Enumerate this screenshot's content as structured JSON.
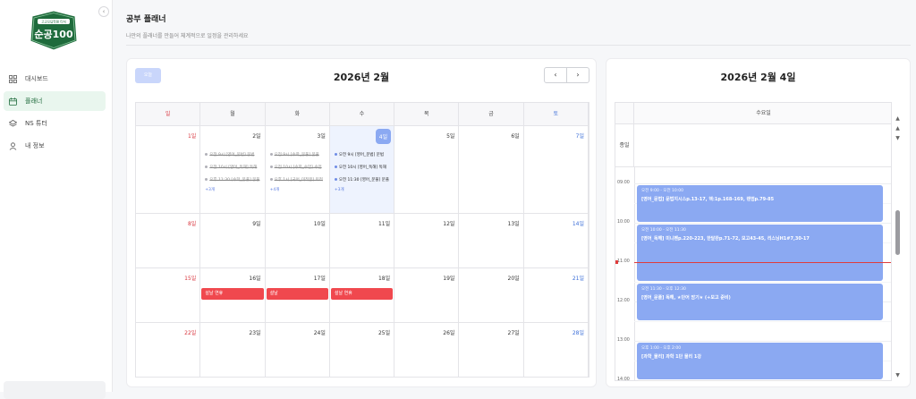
{
  "sidebar": {
    "collapse_icon": "‹",
    "logo_badge": "고교오답학원 티처",
    "logo_text": "순공100",
    "items": [
      {
        "label": "대시보드",
        "icon": "grid-icon",
        "active": false
      },
      {
        "label": "플래너",
        "icon": "calendar-icon",
        "active": true
      },
      {
        "label": "NS 튜터",
        "icon": "layers-icon",
        "active": false
      },
      {
        "label": "내 정보",
        "icon": "user-icon",
        "active": false
      }
    ]
  },
  "header": {
    "title": "공부 플래너",
    "subtitle": "나만의 플래너를 만들어 체계적으로 일정을 관리하세요"
  },
  "calendar": {
    "today_label": "오늘",
    "month_title": "2026년 2월",
    "prev": "‹",
    "next": "›",
    "weekdays": [
      "일",
      "월",
      "화",
      "수",
      "목",
      "금",
      "토"
    ],
    "weeks": [
      [
        {
          "num": "1일",
          "events": []
        },
        {
          "num": "2일",
          "events": [
            {
              "text": "오전 9시 [영어_문법] 문법",
              "done": true
            },
            {
              "text": "오전 10시 [영어_독해] 독해",
              "done": true
            },
            {
              "text": "오후 11:30 [수학_문풀] 문풀",
              "done": true
            }
          ],
          "more": "+3개"
        },
        {
          "num": "3일",
          "events": [
            {
              "text": "오전 9시 [수학_문풀] 문풀",
              "done": true
            },
            {
              "text": "오전 10시 [수학_수업] 수업",
              "done": true
            },
            {
              "text": "오후 1시 [국어_미적분] 미적",
              "done": true
            }
          ],
          "more": "+4개"
        },
        {
          "num": "4일",
          "today": true,
          "events": [
            {
              "text": "오전 9시 [영어_문법] 문법",
              "done": false
            },
            {
              "text": "오전 10시 [영어_독해] 독해",
              "done": false
            },
            {
              "text": "오전 11:30 [영어_문풀] 문풀",
              "done": false
            }
          ],
          "more": "+3개"
        },
        {
          "num": "5일",
          "events": []
        },
        {
          "num": "6일",
          "events": []
        },
        {
          "num": "7일",
          "events": []
        }
      ],
      [
        {
          "num": "8일"
        },
        {
          "num": "9일"
        },
        {
          "num": "10일"
        },
        {
          "num": "11일"
        },
        {
          "num": "12일"
        },
        {
          "num": "13일"
        },
        {
          "num": "14일"
        }
      ],
      [
        {
          "num": "15일"
        },
        {
          "num": "16일"
        },
        {
          "num": "17일"
        },
        {
          "num": "18일"
        },
        {
          "num": "19일"
        },
        {
          "num": "20일"
        },
        {
          "num": "21일"
        }
      ],
      [
        {
          "num": "22일"
        },
        {
          "num": "23일"
        },
        {
          "num": "24일"
        },
        {
          "num": "25일"
        },
        {
          "num": "26일"
        },
        {
          "num": "27일"
        },
        {
          "num": "28일"
        }
      ]
    ],
    "holidays": [
      {
        "label": "설날 연휴",
        "day_index": 1
      },
      {
        "label": "설날",
        "day_index": 2
      },
      {
        "label": "설날 연휴",
        "day_index": 3
      }
    ]
  },
  "day_view": {
    "title": "2026년 2월 4일",
    "column_label": "수요일",
    "allday_label": "종일",
    "time_labels": [
      "09:00",
      "10:00",
      "11:00",
      "12:00",
      "13:00",
      "14:00"
    ],
    "events": [
      {
        "time": "오전 9:00 - 오전 10:00",
        "name": "[영어_문법] 문법지시스p.13-17, 핵:1p.168-169, 랜덤p.79-85",
        "start": 9.0,
        "end": 10.0
      },
      {
        "time": "오전 10:00 - 오전 11:30",
        "name": "[영어_독해] 미니펜p.220-223, 한달완p.71-72, 모고43-45, 리스닝H1#7,30-17",
        "start": 10.0,
        "end": 11.5
      },
      {
        "time": "오전 11:30 - 오후 12:30",
        "name": "[영어_문풀] 독해, ★단어 암기★ (+모고 준비)",
        "start": 11.5,
        "end": 12.5
      },
      {
        "time": "오후 1:00 - 오후 2:00",
        "name": "[과학_물리] 과학 1단 물리 1강",
        "start": 13.0,
        "end": 14.0
      },
      {
        "time": "오후 2:00 - 오후 3:00",
        "name": "",
        "start": 14.0,
        "end": 15.0
      }
    ],
    "now_hour": 11.0,
    "scroll_up": "▲",
    "scroll_down": "▼"
  },
  "colors": {
    "accent": "#8ba9f2",
    "holiday": "#f0484e",
    "now": "#e03c3c",
    "brand": "#1f6b3c"
  }
}
